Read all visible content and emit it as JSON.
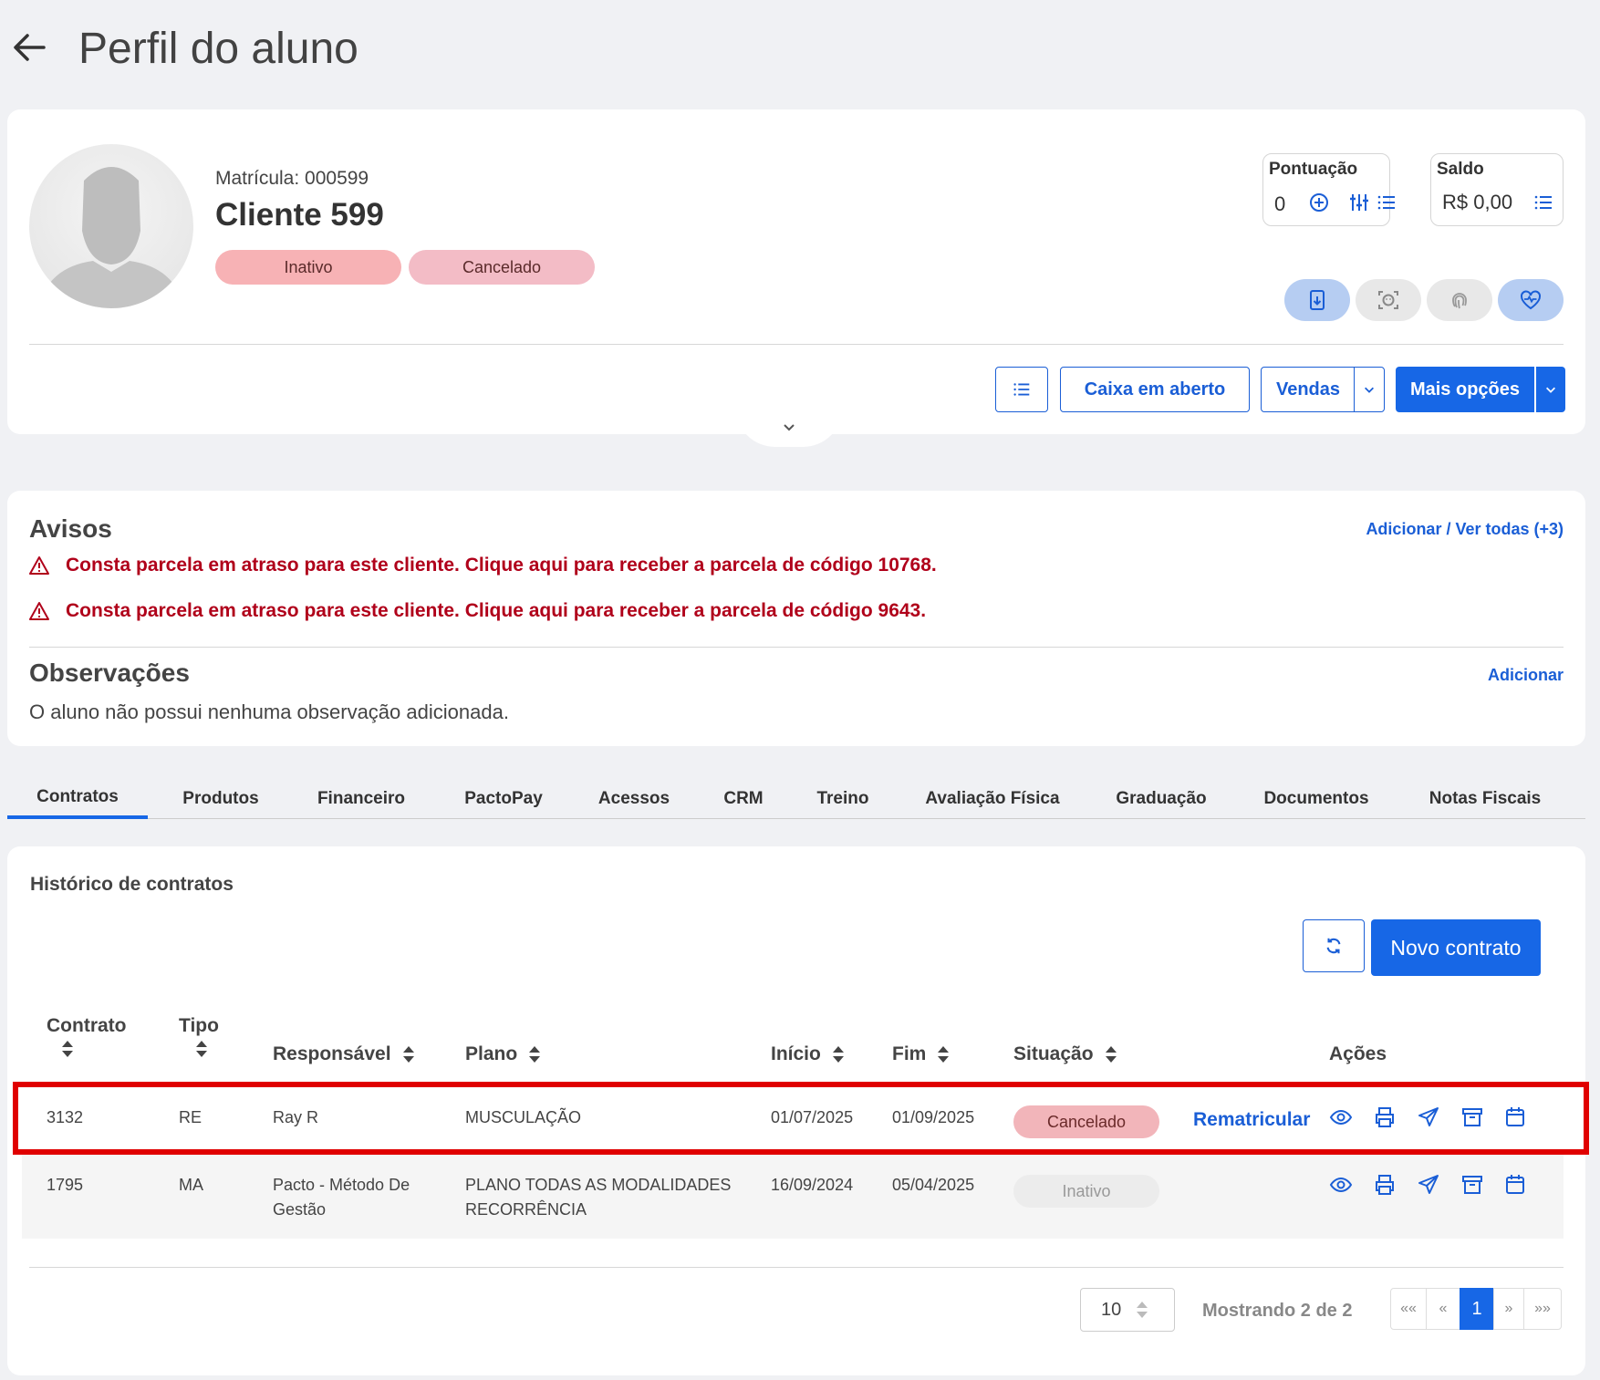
{
  "header": {
    "title": "Perfil do aluno"
  },
  "profile": {
    "matricula": "Matrícula: 000599",
    "name": "Cliente 599",
    "badges": [
      "Inativo",
      "Cancelado"
    ],
    "pontuacao": {
      "label": "Pontuação",
      "value": "0"
    },
    "saldo": {
      "label": "Saldo",
      "value": "R$ 0,00"
    },
    "actions": {
      "caixa": "Caixa em aberto",
      "vendas": "Vendas",
      "mais": "Mais opções"
    }
  },
  "avisos": {
    "title": "Avisos",
    "link": "Adicionar / Ver todas (+3)",
    "items": [
      "Consta parcela em atraso para este cliente. Clique aqui para receber a parcela de código 10768.",
      "Consta parcela em atraso para este cliente. Clique aqui para receber a parcela de código 9643."
    ]
  },
  "observacoes": {
    "title": "Observações",
    "link": "Adicionar",
    "text": "O aluno não possui nenhuma observação adicionada."
  },
  "tabs": [
    "Contratos",
    "Produtos",
    "Financeiro",
    "PactoPay",
    "Acessos",
    "CRM",
    "Treino",
    "Avaliação Física",
    "Graduação",
    "Documentos",
    "Notas Fiscais"
  ],
  "contracts": {
    "title": "Histórico de contratos",
    "new_button": "Novo contrato",
    "columns": [
      "Contrato",
      "Tipo",
      "Responsável",
      "Plano",
      "Início",
      "Fim",
      "Situação",
      "Ações"
    ],
    "rows": [
      {
        "contrato": "3132",
        "tipo": "RE",
        "responsavel": "Ray R",
        "plano": "MUSCULAÇÃO",
        "inicio": "01/07/2025",
        "fim": "01/09/2025",
        "situacao": "Cancelado",
        "extra": "Rematricular"
      },
      {
        "contrato": "1795",
        "tipo": "MA",
        "responsavel": "Pacto - Método De Gestão",
        "plano": "PLANO TODAS AS MODALIDADES RECORRÊNCIA",
        "inicio": "16/09/2024",
        "fim": "05/04/2025",
        "situacao": "Inativo",
        "extra": ""
      }
    ],
    "page_size": "10",
    "showing": "Mostrando 2 de 2",
    "pager": {
      "first": "««",
      "prev": "«",
      "current": "1",
      "next": "»",
      "last": "»»"
    }
  },
  "colors": {
    "accent": "#1767e6",
    "danger": "#b0001a",
    "highlight": "#e00000"
  }
}
